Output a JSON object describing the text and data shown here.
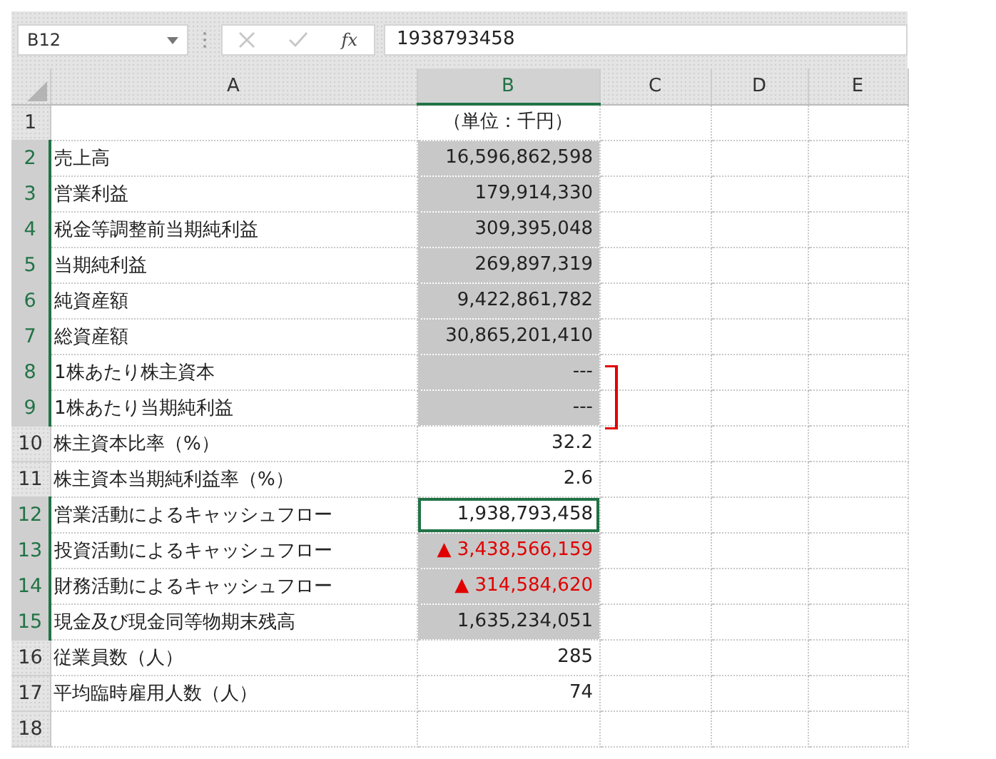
{
  "name_box": {
    "value": "B12"
  },
  "function_label": "fx",
  "formula": {
    "value": "1938793458"
  },
  "columns": [
    {
      "label": "A",
      "selected": false
    },
    {
      "label": "B",
      "selected": true
    },
    {
      "label": "C",
      "selected": false
    },
    {
      "label": "D",
      "selected": false
    },
    {
      "label": "E",
      "selected": false
    }
  ],
  "rows": [
    {
      "number": "1",
      "value": "（単位：千円）",
      "selected": false,
      "active": false,
      "negative": false,
      "bracketed": false
    },
    {
      "number": "2",
      "label": "売上高",
      "value": "16,596,862,598",
      "selected": true,
      "active": false,
      "negative": false,
      "bracketed": false
    },
    {
      "number": "3",
      "label": "営業利益",
      "value": "179,914,330",
      "selected": true,
      "active": false,
      "negative": false,
      "bracketed": false
    },
    {
      "number": "4",
      "label": "税金等調整前当期純利益",
      "value": "309,395,048",
      "selected": true,
      "active": false,
      "negative": false,
      "bracketed": false
    },
    {
      "number": "5",
      "label": "当期純利益",
      "value": "269,897,319",
      "selected": true,
      "active": false,
      "negative": false,
      "bracketed": false
    },
    {
      "number": "6",
      "label": "純資産額",
      "value": "9,422,861,782",
      "selected": true,
      "active": false,
      "negative": false,
      "bracketed": false
    },
    {
      "number": "7",
      "label": "総資産額",
      "value": "30,865,201,410",
      "selected": true,
      "active": false,
      "negative": false,
      "bracketed": false
    },
    {
      "number": "8",
      "label": "1株あたり株主資本",
      "value": "---",
      "selected": true,
      "active": false,
      "negative": false,
      "bracketed": true
    },
    {
      "number": "9",
      "label": "1株あたり当期純利益",
      "value": "---",
      "selected": true,
      "active": false,
      "negative": false,
      "bracketed": true
    },
    {
      "number": "10",
      "label": "株主資本比率（%）",
      "value": "32.2",
      "selected": false,
      "active": false,
      "negative": false,
      "bracketed": false
    },
    {
      "number": "11",
      "label": "株主資本当期純利益率（%）",
      "value": "2.6",
      "selected": false,
      "active": false,
      "negative": false,
      "bracketed": false
    },
    {
      "number": "12",
      "label": "営業活動によるキャッシュフロー",
      "value": "1,938,793,458",
      "selected": true,
      "active": true,
      "negative": false,
      "bracketed": false
    },
    {
      "number": "13",
      "label": "投資活動によるキャッシュフロー",
      "value": "▲ 3,438,566,159",
      "selected": true,
      "active": false,
      "negative": true,
      "bracketed": false
    },
    {
      "number": "14",
      "label": "財務活動によるキャッシュフロー",
      "value": "▲ 314,584,620",
      "selected": true,
      "active": false,
      "negative": true,
      "bracketed": false
    },
    {
      "number": "15",
      "label": "現金及び現金同等物期末残高",
      "value": "1,635,234,051",
      "selected": true,
      "active": false,
      "negative": false,
      "bracketed": false
    },
    {
      "number": "16",
      "label": "従業員数（人）",
      "value": "285",
      "selected": false,
      "active": false,
      "negative": false,
      "bracketed": false
    },
    {
      "number": "17",
      "label": "平均臨時雇用人数（人）",
      "value": "74",
      "selected": false,
      "active": false,
      "negative": false,
      "bracketed": false
    },
    {
      "number": "18",
      "selected": false
    }
  ]
}
